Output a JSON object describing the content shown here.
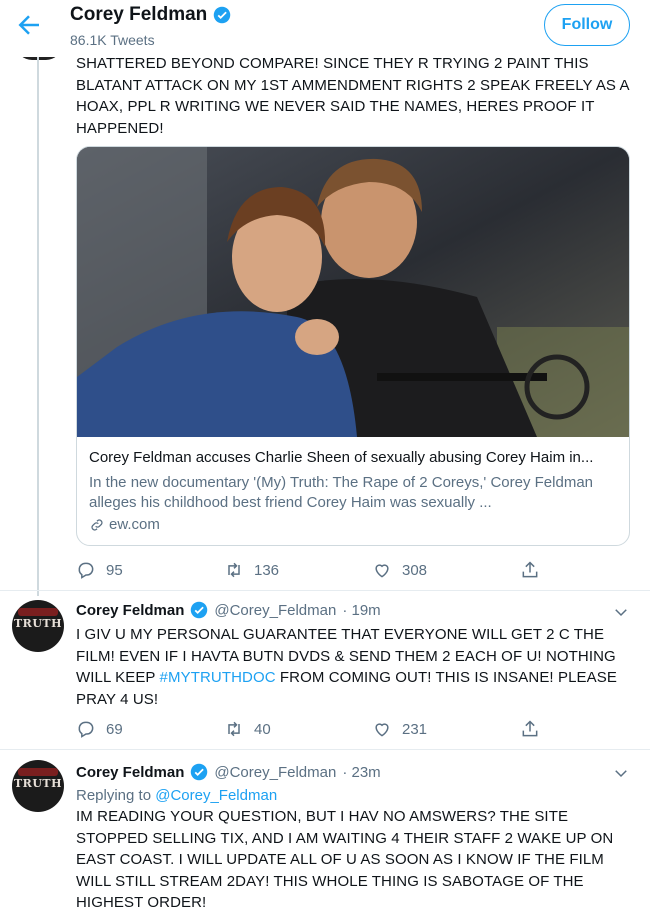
{
  "header": {
    "name": "Corey Feldman",
    "tweet_count": "86.1K Tweets",
    "follow_label": "Follow"
  },
  "tweet1": {
    "text": "SHATTERED BEYOND COMPARE! SINCE THEY R TRYING 2 PAINT THIS BLATANT ATTACK ON MY 1ST AMMENDMENT RIGHTS 2 SPEAK FREELY AS  A HOAX, PPL R WRITING WE NEVER SAID THE NAMES, HERES PROOF IT HAPPENED!",
    "card": {
      "title": "Corey Feldman accuses Charlie Sheen of sexually abusing Corey Haim in...",
      "description": "In the new documentary '(My) Truth: The Rape of 2 Coreys,' Corey Feldman alleges his childhood best friend Corey Haim was sexually ...",
      "domain": "ew.com"
    },
    "replies": "95",
    "retweets": "136",
    "likes": "308"
  },
  "tweet2": {
    "name": "Corey Feldman",
    "handle": "@Corey_Feldman",
    "time": "· 19m",
    "text_before": "I GIV U MY PERSONAL GUARANTEE THAT EVERYONE WILL GET 2 C THE FILM! EVEN IF I HAVTA BUTN DVDS & SEND THEM 2 EACH OF U! NOTHING WILL KEEP ",
    "hashtag": "#MYTRUTHDOC",
    "text_after": " FROM COMING OUT! THIS IS INSANE! PLEASE PRAY 4 US!",
    "replies": "69",
    "retweets": "40",
    "likes": "231",
    "avatar_text": "TRUTH"
  },
  "tweet3": {
    "name": "Corey Feldman",
    "handle": "@Corey_Feldman",
    "time": "· 23m",
    "replying_prefix": "Replying to ",
    "replying_handle": "@Corey_Feldman",
    "text": "IM READING YOUR QUESTION, BUT I HAV NO AMSWERS? THE SITE STOPPED SELLING TIX, AND I AM WAITING 4 THEIR STAFF 2 WAKE UP ON EAST COAST. I WILL UPDATE ALL OF U AS SOON AS I KNOW IF THE FILM WILL STILL STREAM 2DAY! THIS WHOLE THING IS SABOTAGE OF THE HIGHEST ORDER!",
    "avatar_text": "TRUTH"
  },
  "colors": {
    "accent": "#1da1f2",
    "secondary_text": "#5b7083",
    "border": "#cfd9de"
  },
  "icons": [
    "back-arrow-icon",
    "verified-badge-icon",
    "reply-icon",
    "retweet-icon",
    "like-icon",
    "share-icon",
    "link-icon",
    "chevron-down-icon"
  ]
}
